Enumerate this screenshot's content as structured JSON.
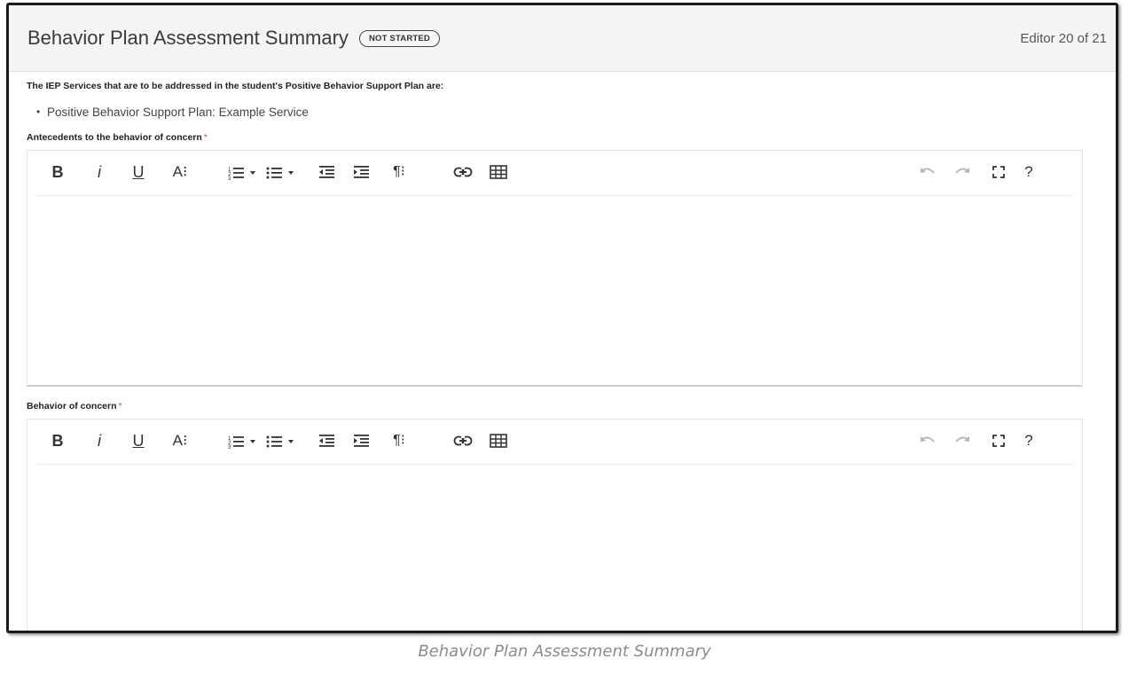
{
  "header": {
    "title": "Behavior Plan Assessment Summary",
    "status_badge": "NOT STARTED",
    "editor_count": "Editor 20 of 21"
  },
  "intro_text": "The IEP Services that are to be addressed in the student's Positive Behavior Support Plan are:",
  "services": [
    "Positive Behavior Support Plan: Example Service"
  ],
  "fields": [
    {
      "label": "Antecedents to the behavior of concern",
      "required_mark": "*",
      "value": ""
    },
    {
      "label": "Behavior of concern",
      "required_mark": "*",
      "value": ""
    }
  ],
  "toolbar": {
    "bold": "B",
    "italic": "i",
    "underline": "U",
    "font_size": "A⁝",
    "help": "?"
  },
  "caption": "Behavior Plan Assessment Summary",
  "colors": {
    "header_bg": "#f5f5f5",
    "required": "#e04848",
    "disabled_icon": "#b5b5b5"
  }
}
